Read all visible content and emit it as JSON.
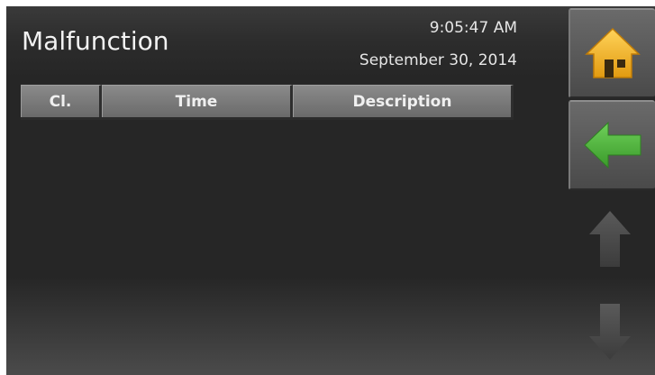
{
  "header": {
    "title": "Malfunction",
    "time": "9:05:47 AM",
    "date": "September 30, 2014"
  },
  "table": {
    "columns": [
      "Cl.",
      "Time",
      "Description"
    ],
    "rows": []
  },
  "side_nav": {
    "home_icon": "home-icon",
    "back_icon": "back-arrow-icon",
    "up_icon": "scroll-up-arrow-icon",
    "down_icon": "scroll-down-arrow-icon"
  },
  "colors": {
    "home_icon": "#f0b526",
    "back_icon": "#4caf3a",
    "scroll_arrows": "#4a4a4a"
  }
}
